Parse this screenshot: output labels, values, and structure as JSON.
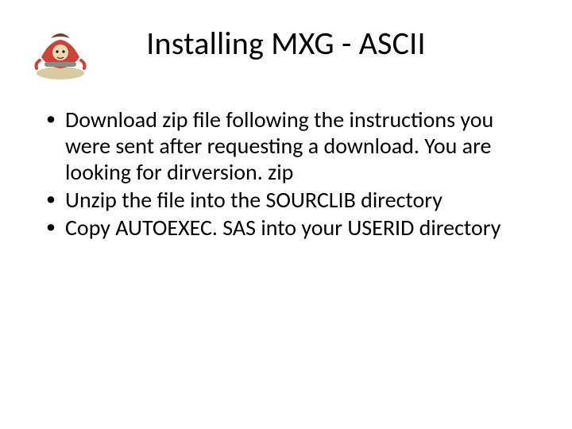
{
  "title": "Installing MXG - ASCII",
  "bullets": [
    "Download zip file following the instructions you were sent after requesting a download. You are looking for dirversion. zip",
    "Unzip the file into the SOURCLIB directory",
    "Copy AUTOEXEC. SAS into your USERID directory"
  ],
  "logo_alt": "cartoon-mascot"
}
